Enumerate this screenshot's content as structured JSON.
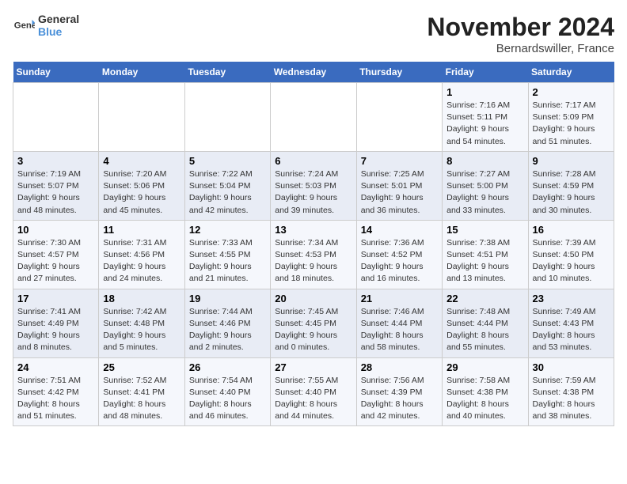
{
  "logo": {
    "line1": "General",
    "line2": "Blue"
  },
  "title": "November 2024",
  "subtitle": "Bernardswiller, France",
  "days_of_week": [
    "Sunday",
    "Monday",
    "Tuesday",
    "Wednesday",
    "Thursday",
    "Friday",
    "Saturday"
  ],
  "weeks": [
    [
      {
        "day": "",
        "info": ""
      },
      {
        "day": "",
        "info": ""
      },
      {
        "day": "",
        "info": ""
      },
      {
        "day": "",
        "info": ""
      },
      {
        "day": "",
        "info": ""
      },
      {
        "day": "1",
        "info": "Sunrise: 7:16 AM\nSunset: 5:11 PM\nDaylight: 9 hours and 54 minutes."
      },
      {
        "day": "2",
        "info": "Sunrise: 7:17 AM\nSunset: 5:09 PM\nDaylight: 9 hours and 51 minutes."
      }
    ],
    [
      {
        "day": "3",
        "info": "Sunrise: 7:19 AM\nSunset: 5:07 PM\nDaylight: 9 hours and 48 minutes."
      },
      {
        "day": "4",
        "info": "Sunrise: 7:20 AM\nSunset: 5:06 PM\nDaylight: 9 hours and 45 minutes."
      },
      {
        "day": "5",
        "info": "Sunrise: 7:22 AM\nSunset: 5:04 PM\nDaylight: 9 hours and 42 minutes."
      },
      {
        "day": "6",
        "info": "Sunrise: 7:24 AM\nSunset: 5:03 PM\nDaylight: 9 hours and 39 minutes."
      },
      {
        "day": "7",
        "info": "Sunrise: 7:25 AM\nSunset: 5:01 PM\nDaylight: 9 hours and 36 minutes."
      },
      {
        "day": "8",
        "info": "Sunrise: 7:27 AM\nSunset: 5:00 PM\nDaylight: 9 hours and 33 minutes."
      },
      {
        "day": "9",
        "info": "Sunrise: 7:28 AM\nSunset: 4:59 PM\nDaylight: 9 hours and 30 minutes."
      }
    ],
    [
      {
        "day": "10",
        "info": "Sunrise: 7:30 AM\nSunset: 4:57 PM\nDaylight: 9 hours and 27 minutes."
      },
      {
        "day": "11",
        "info": "Sunrise: 7:31 AM\nSunset: 4:56 PM\nDaylight: 9 hours and 24 minutes."
      },
      {
        "day": "12",
        "info": "Sunrise: 7:33 AM\nSunset: 4:55 PM\nDaylight: 9 hours and 21 minutes."
      },
      {
        "day": "13",
        "info": "Sunrise: 7:34 AM\nSunset: 4:53 PM\nDaylight: 9 hours and 18 minutes."
      },
      {
        "day": "14",
        "info": "Sunrise: 7:36 AM\nSunset: 4:52 PM\nDaylight: 9 hours and 16 minutes."
      },
      {
        "day": "15",
        "info": "Sunrise: 7:38 AM\nSunset: 4:51 PM\nDaylight: 9 hours and 13 minutes."
      },
      {
        "day": "16",
        "info": "Sunrise: 7:39 AM\nSunset: 4:50 PM\nDaylight: 9 hours and 10 minutes."
      }
    ],
    [
      {
        "day": "17",
        "info": "Sunrise: 7:41 AM\nSunset: 4:49 PM\nDaylight: 9 hours and 8 minutes."
      },
      {
        "day": "18",
        "info": "Sunrise: 7:42 AM\nSunset: 4:48 PM\nDaylight: 9 hours and 5 minutes."
      },
      {
        "day": "19",
        "info": "Sunrise: 7:44 AM\nSunset: 4:46 PM\nDaylight: 9 hours and 2 minutes."
      },
      {
        "day": "20",
        "info": "Sunrise: 7:45 AM\nSunset: 4:45 PM\nDaylight: 9 hours and 0 minutes."
      },
      {
        "day": "21",
        "info": "Sunrise: 7:46 AM\nSunset: 4:44 PM\nDaylight: 8 hours and 58 minutes."
      },
      {
        "day": "22",
        "info": "Sunrise: 7:48 AM\nSunset: 4:44 PM\nDaylight: 8 hours and 55 minutes."
      },
      {
        "day": "23",
        "info": "Sunrise: 7:49 AM\nSunset: 4:43 PM\nDaylight: 8 hours and 53 minutes."
      }
    ],
    [
      {
        "day": "24",
        "info": "Sunrise: 7:51 AM\nSunset: 4:42 PM\nDaylight: 8 hours and 51 minutes."
      },
      {
        "day": "25",
        "info": "Sunrise: 7:52 AM\nSunset: 4:41 PM\nDaylight: 8 hours and 48 minutes."
      },
      {
        "day": "26",
        "info": "Sunrise: 7:54 AM\nSunset: 4:40 PM\nDaylight: 8 hours and 46 minutes."
      },
      {
        "day": "27",
        "info": "Sunrise: 7:55 AM\nSunset: 4:40 PM\nDaylight: 8 hours and 44 minutes."
      },
      {
        "day": "28",
        "info": "Sunrise: 7:56 AM\nSunset: 4:39 PM\nDaylight: 8 hours and 42 minutes."
      },
      {
        "day": "29",
        "info": "Sunrise: 7:58 AM\nSunset: 4:38 PM\nDaylight: 8 hours and 40 minutes."
      },
      {
        "day": "30",
        "info": "Sunrise: 7:59 AM\nSunset: 4:38 PM\nDaylight: 8 hours and 38 minutes."
      }
    ]
  ]
}
